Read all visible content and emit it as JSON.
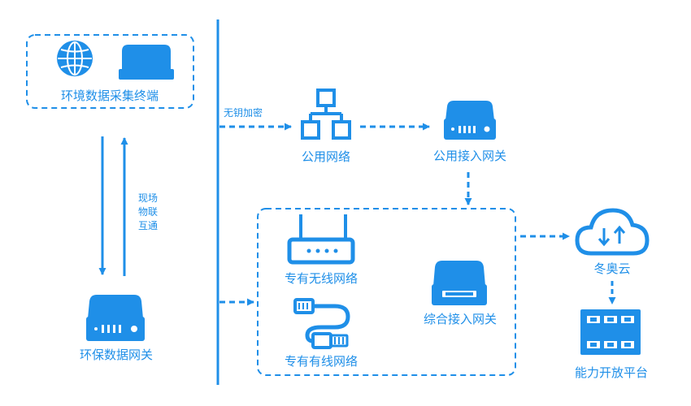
{
  "labels": {
    "terminal": "环境数据采集终端",
    "eco_gateway": "环保数据网关",
    "onsite_iot": [
      "现场",
      "物联",
      "互通"
    ],
    "keyless": "无钥加密",
    "public_network": "公用网络",
    "public_gateway": "公用接入网关",
    "private_wireless": "专有无线网络",
    "private_wired": "专有有线网络",
    "integrated_gateway": "综合接入网关",
    "cloud": "冬奥云",
    "platform": "能力开放平台"
  },
  "icons": {
    "terminal": [
      "globe-icon",
      "server-icon"
    ],
    "eco_gateway": "server-icon",
    "public_network": "network-topology-icon",
    "public_gateway": "server-icon",
    "private_wireless": "router-icon",
    "private_wired": "cable-icon",
    "integrated_gateway": "server-icon",
    "cloud": "cloud-sync-icon",
    "platform": "film-grid-icon"
  },
  "colors": {
    "accent": "#1f8fe8"
  }
}
